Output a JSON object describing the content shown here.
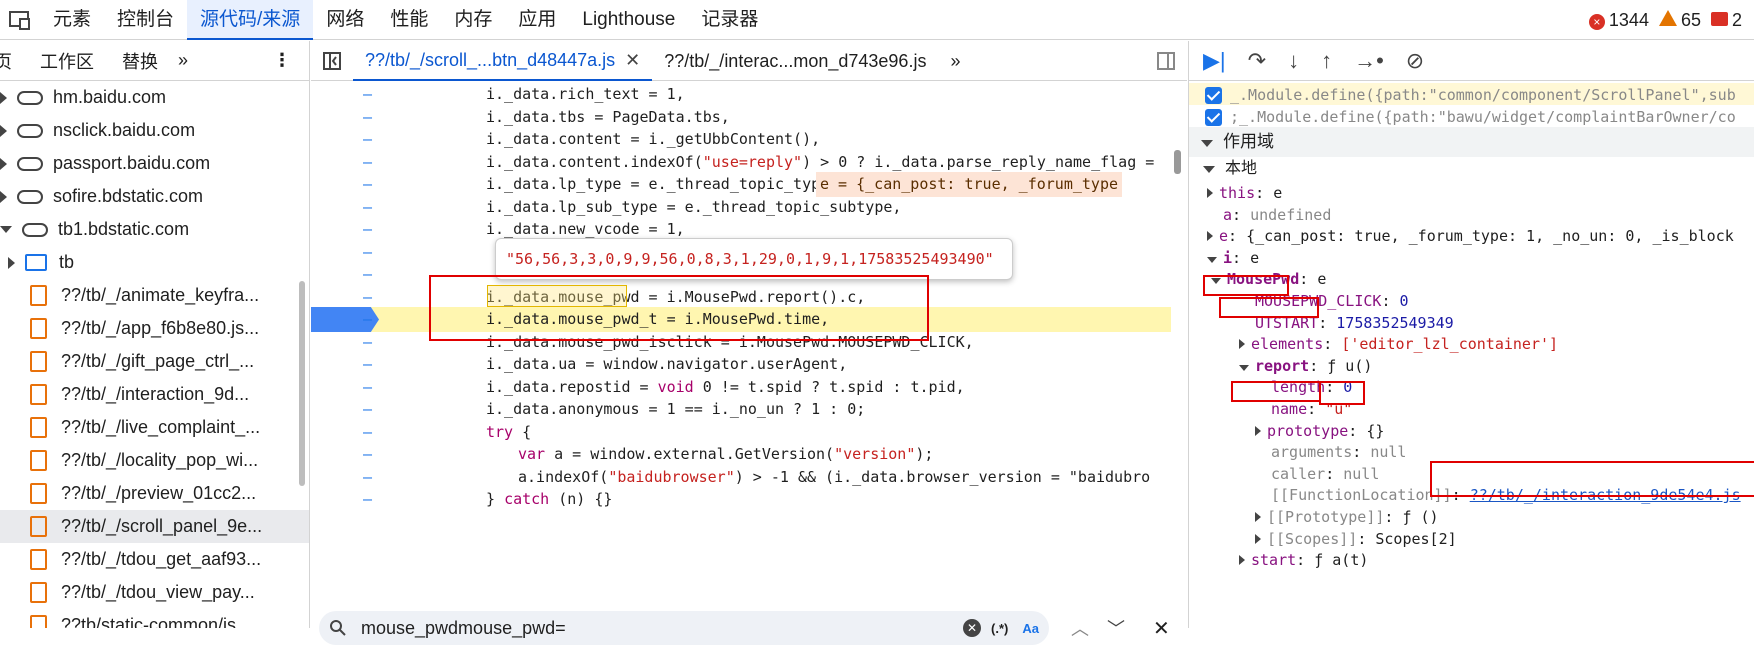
{
  "topbar": {
    "tabs": [
      "元素",
      "控制台",
      "源代码/来源",
      "网络",
      "性能",
      "内存",
      "应用",
      "Lighthouse",
      "记录器"
    ],
    "active_tab": 2,
    "errors": "1344",
    "warnings": "65",
    "messages": "2"
  },
  "navigator": {
    "tabs": [
      "页",
      "工作区",
      "替换"
    ],
    "more": "»",
    "items": [
      {
        "type": "cloud",
        "label": "hm.baidu.com"
      },
      {
        "type": "cloud",
        "label": "nsclick.baidu.com"
      },
      {
        "type": "cloud",
        "label": "passport.baidu.com"
      },
      {
        "type": "cloud",
        "label": "sofire.bdstatic.com"
      },
      {
        "type": "cloud",
        "label": "tb1.bdstatic.com"
      },
      {
        "type": "folder",
        "label": "tb"
      },
      {
        "type": "file",
        "label": "??/tb/_/animate_keyfra..."
      },
      {
        "type": "file",
        "label": "??/tb/_/app_f6b8e80.js..."
      },
      {
        "type": "file",
        "label": "??/tb/_/gift_page_ctrl_..."
      },
      {
        "type": "file",
        "label": "??/tb/_/interaction_9d..."
      },
      {
        "type": "file",
        "label": "??/tb/_/live_complaint_..."
      },
      {
        "type": "file",
        "label": "??/tb/_/locality_pop_wi..."
      },
      {
        "type": "file",
        "label": "??/tb/_/preview_01cc2..."
      },
      {
        "type": "file",
        "label": "??/tb/_/scroll_panel_9e..."
      },
      {
        "type": "file",
        "label": "??/tb/_/tdou_get_aaf93..."
      },
      {
        "type": "file",
        "label": "??/tb/_/tdou_view_pay..."
      },
      {
        "type": "file",
        "label": "??tb/static-common/js..."
      }
    ]
  },
  "editor": {
    "tabs": [
      "??/tb/_/scroll_...btn_d48447a.js",
      "??/tb/_/interac...mon_d743e96.js"
    ],
    "lines": [
      "i._data.rich_text = 1,",
      "i._data.tbs = PageData.tbs,",
      "i._data.content = i._getUbbContent(),",
      "i._data.content.indexOf(\"use=reply\") > 0 ? i._data.parse_reply_name_flag = ",
      "i._data.lp_type = e._thread_topic_type,",
      "i._data.lp_sub_type = e._thread_topic_subtype,",
      "i._data.new_vcode = 1,",
      "",
      "",
      "i._data.mouse_pwd = i.MousePwd.report().c,",
      "i._data.mouse_pwd_t = i.MousePwd.time,",
      "i._data.mouse_pwd_isclick = i.MousePwd.MOUSEPWD_CLICK,",
      "i._data.ua = window.navigator.userAgent,",
      "i._data.repostid = void 0 != t.spid ? t.spid : t.pid,",
      "i._data.anonymous = 1 == i._no_un ? 1 : 0;",
      "try {",
      "    var a = window.external.GetVersion(\"version\");",
      "    a.indexOf(\"baidubrowser\") > -1 && (i._data.browser_version = \"baidubro",
      "} catch (n) {}"
    ],
    "inline_value": "e = {_can_post: true, _forum_type",
    "tooltip_value": "\"56,56,3,3,0,9,9,56,0,8,3,1,29,0,1,9,1,17583525493490\"",
    "search_query": "mouse_pwdmouse_pwd=",
    "search_regex": "(.*)",
    "search_case": "Aa"
  },
  "scope": {
    "callstack_rows": [
      "_.Module.define({path:\"common/component/ScrollPanel\",sub",
      ";_.Module.define({path:\"bawu/widget/complaintBarOwner/co"
    ],
    "section": "作用域",
    "local": "本地",
    "rows": [
      {
        "indent": 1,
        "arrow": "right",
        "key": "this",
        "val": "e"
      },
      {
        "indent": 1,
        "arrow": "",
        "key": "a",
        "val": "undefined"
      },
      {
        "indent": 1,
        "arrow": "right",
        "key": "e",
        "val": "{_can_post: true, _forum_type: 1, _no_un: 0, _is_block"
      },
      {
        "indent": 1,
        "arrow": "down",
        "key": "i",
        "val": "e"
      },
      {
        "indent": 2,
        "arrow": "down",
        "key": "MousePwd",
        "val": "e"
      },
      {
        "indent": 3,
        "arrow": "",
        "key": "MOUSEPWD_CLICK",
        "val": "0"
      },
      {
        "indent": 3,
        "arrow": "",
        "key": "UTSTART",
        "val": "1758352549349"
      },
      {
        "indent": 3,
        "arrow": "right",
        "key": "elements",
        "val": "['editor_lzl_container']"
      },
      {
        "indent": 3,
        "arrow": "down",
        "key": "report",
        "val": "ƒ u()"
      },
      {
        "indent": 4,
        "arrow": "",
        "key": "length",
        "val": "0"
      },
      {
        "indent": 4,
        "arrow": "",
        "key": "name",
        "val": "\"u\""
      },
      {
        "indent": 4,
        "arrow": "right",
        "key": "prototype",
        "val": "{}"
      },
      {
        "indent": 4,
        "arrow": "",
        "key": "arguments",
        "val": "null"
      },
      {
        "indent": 4,
        "arrow": "",
        "key": "caller",
        "val": "null"
      },
      {
        "indent": 4,
        "arrow": "",
        "key": "[[FunctionLocation]]",
        "val": "??/tb/_/interaction_9de54e4.js"
      },
      {
        "indent": 4,
        "arrow": "right",
        "key": "[[Prototype]]",
        "val": "ƒ ()"
      },
      {
        "indent": 4,
        "arrow": "right",
        "key": "[[Scopes]]",
        "val": "Scopes[2]"
      },
      {
        "indent": 3,
        "arrow": "right",
        "key": "start",
        "val": "ƒ a(t)"
      }
    ]
  }
}
